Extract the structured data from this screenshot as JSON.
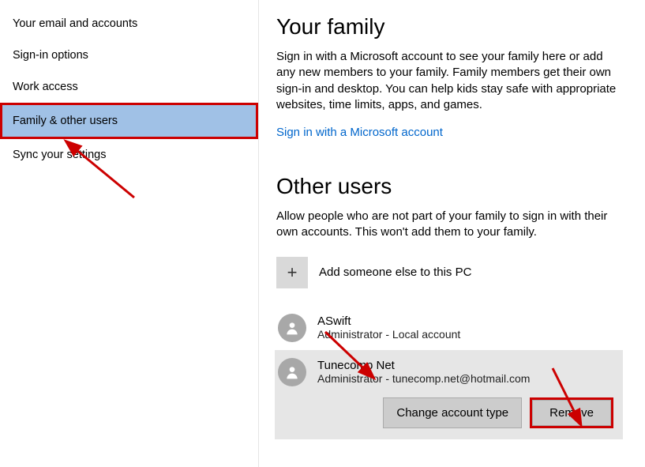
{
  "sidebar": {
    "items": [
      {
        "label": "Your email and accounts"
      },
      {
        "label": "Sign-in options"
      },
      {
        "label": "Work access"
      },
      {
        "label": "Family & other users"
      },
      {
        "label": "Sync your settings"
      }
    ]
  },
  "family": {
    "heading": "Your family",
    "description": "Sign in with a Microsoft account to see your family here or add any new members to your family. Family members get their own sign-in and desktop. You can help kids stay safe with appropriate websites, time limits, apps, and games.",
    "sign_in_link": "Sign in with a Microsoft account"
  },
  "other": {
    "heading": "Other users",
    "description": "Allow people who are not part of your family to sign in with their own accounts. This won't add them to your family.",
    "add_label": "Add someone else to this PC",
    "users": [
      {
        "name": "ASwift",
        "subtitle": "Administrator - Local account"
      },
      {
        "name": "Tunecomp Net",
        "subtitle": "Administrator - tunecomp.net@hotmail.com"
      }
    ],
    "actions": {
      "change_type": "Change account type",
      "remove": "Remove"
    }
  }
}
